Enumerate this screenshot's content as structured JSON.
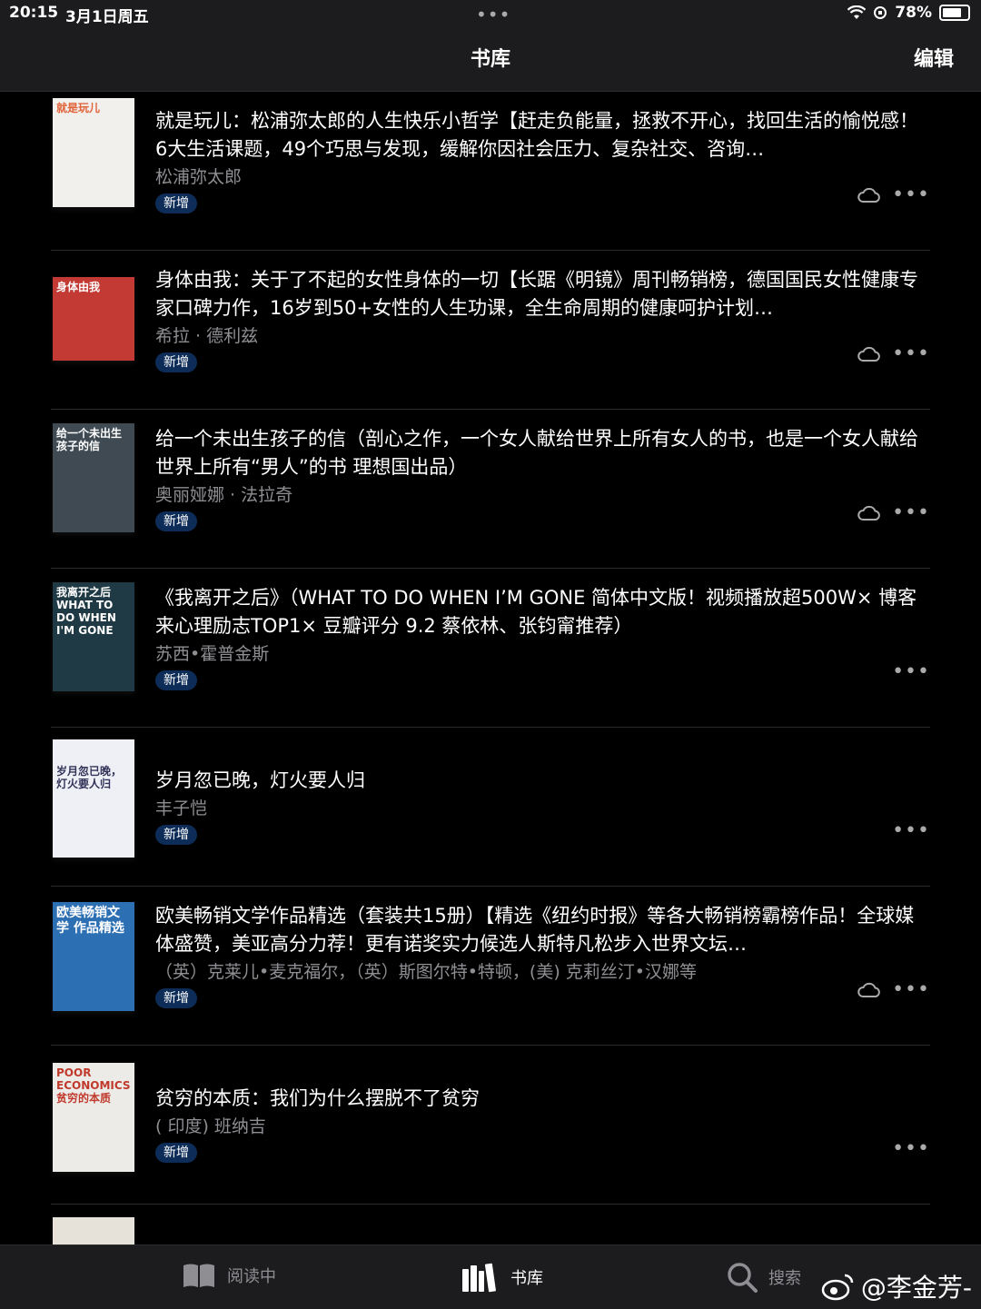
{
  "status": {
    "time": "20:15",
    "date": "3月1日周五",
    "battery": "78%",
    "battery_level": 0.78,
    "dots": "•••"
  },
  "nav": {
    "title": "书库",
    "edit": "编辑"
  },
  "books": [
    {
      "title": "就是玩儿：松浦弥太郎的人生快乐小哲学【赶走负能量，拯救不开心，找回生活的愉悦感！6大生活课题，49个巧思与发现，缓解你因社会压力、复杂社交、咨询…",
      "author": "松浦弥太郎",
      "badge": "新增",
      "cloud": true,
      "cover_text": "就是玩儿",
      "cover_color": "#f2f0ec",
      "cover_text_color": "#e0633a"
    },
    {
      "title": "身体由我：关于了不起的女性身体的一切【长踞《明镜》周刊畅销榜，德国国民女性健康专家口碑力作，16岁到50+女性的人生功课，全生命周期的健康呵护计划…",
      "author": "希拉 · 德利兹",
      "badge": "新增",
      "cloud": true,
      "cover_text": "身体由我",
      "cover_color": "#c23a33",
      "cover_text_color": "#ffffff"
    },
    {
      "title": "给一个未出生孩子的信（剖心之作，一个女人献给世界上所有女人的书，也是一个女人献给世界上所有“男人”的书 理想国出品）",
      "author": "奥丽娅娜 · 法拉奇",
      "badge": "新增",
      "cloud": true,
      "cover_text": "给一个未出生孩子的信",
      "cover_color": "#3f4a52",
      "cover_text_color": "#ffffff"
    },
    {
      "title": "《我离开之后》（WHAT TO DO WHEN I’M GONE 简体中文版！视频播放超500W× 博客来心理励志TOP1× 豆瓣评分 9.2 蔡依林、张钧甯推荐）",
      "author": "苏西•霍普金斯",
      "badge": "新增",
      "cloud": false,
      "cover_text": "我离开之后 WHAT TO DO WHEN I'M GONE",
      "cover_color": "#1f3a44",
      "cover_text_color": "#ffffff"
    },
    {
      "title": "岁月忽已晚，灯火要人归",
      "author": "丰子恺",
      "badge": "新增",
      "cloud": false,
      "cover_text": "岁月忽已晚，灯火要人归",
      "cover_color": "#eef0f5",
      "cover_text_color": "#33335a"
    },
    {
      "title": "欧美畅销文学作品精选（套装共15册）【精选《纽约时报》等各大畅销榜霸榜作品！全球媒体盛赞，美亚高分力荐！更有诺奖实力候选人斯特凡松步入世界文坛…",
      "author": "（英）克莱儿•麦克福尔，（英）斯图尔特•特顿，(美) 克莉丝汀•汉娜等",
      "badge": "新增",
      "cloud": true,
      "cover_text": "欧美畅销文学 作品精选",
      "cover_color": "#2c6fb3",
      "cover_text_color": "#ffffff"
    },
    {
      "title": "贫穷的本质：我们为什么摆脱不了贫穷",
      "author": "( 印度) 班纳吉",
      "badge": "新增",
      "cloud": false,
      "cover_text": "POOR ECONOMICS 贫穷的本质",
      "cover_color": "#ecebe8",
      "cover_text_color": "#c0392b"
    },
    {
      "title": "",
      "author": "",
      "badge": "",
      "cloud": false,
      "cover_text": "",
      "cover_color": "#e6e2da",
      "cover_text_color": "#333333"
    }
  ],
  "tabs": [
    {
      "label": "阅读中",
      "icon": "book-open-icon",
      "active": false
    },
    {
      "label": "书库",
      "icon": "library-icon",
      "active": true
    },
    {
      "label": "搜索",
      "icon": "search-icon",
      "active": false
    }
  ],
  "watermark": "@李金芳-",
  "colors": {
    "accent_badge": "#0d2c57",
    "background": "#000000",
    "bar": "#1c1c1e",
    "secondary_text": "#8e8e93"
  }
}
